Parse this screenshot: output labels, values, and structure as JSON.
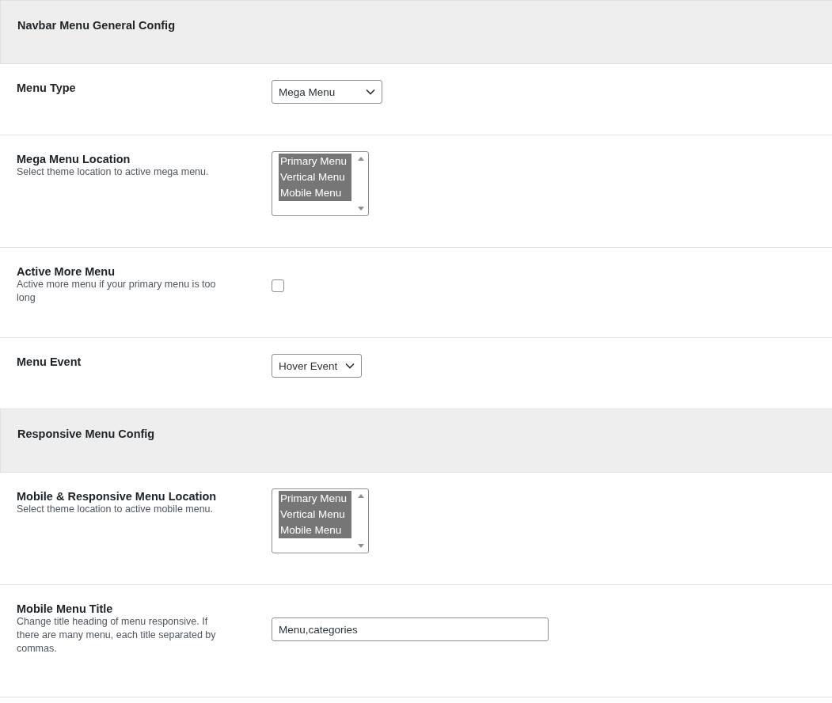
{
  "sections": [
    {
      "heading": "Navbar Menu General Config",
      "fields": [
        {
          "kind": "select",
          "label": "Menu Type",
          "value": "Mega Menu"
        },
        {
          "kind": "multiselect",
          "label": "Mega Menu Location",
          "description": "Select theme location to active mega menu.",
          "options": [
            {
              "label": "Primary Menu",
              "selected": true
            },
            {
              "label": "Vertical Menu",
              "selected": true
            },
            {
              "label": "Mobile Menu",
              "selected": true
            }
          ]
        },
        {
          "kind": "checkbox",
          "label": "Active More Menu",
          "description": "Active more menu if your primary menu is too long",
          "checked": false
        },
        {
          "kind": "select",
          "label": "Menu Event",
          "value": "Hover Event"
        }
      ]
    },
    {
      "heading": "Responsive Menu Config",
      "fields": [
        {
          "kind": "multiselect",
          "label": "Mobile & Responsive Menu Location",
          "description": "Select theme location to active mobile menu.",
          "options": [
            {
              "label": "Primary Menu",
              "selected": true
            },
            {
              "label": "Vertical Menu",
              "selected": true
            },
            {
              "label": "Mobile Menu",
              "selected": true
            }
          ]
        },
        {
          "kind": "text",
          "label": "Mobile Menu Title",
          "description": "Change title heading of menu responsive. If there are many menu, each title separated by commas.",
          "value": "Menu,categories"
        }
      ]
    }
  ]
}
